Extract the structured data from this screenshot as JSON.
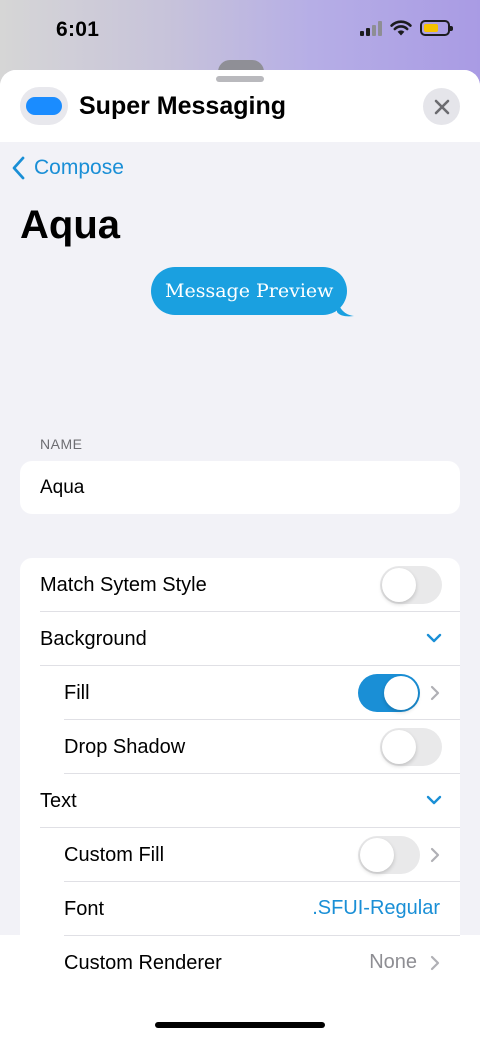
{
  "status_bar": {
    "time": "6:01",
    "battery_level": 0.62
  },
  "header": {
    "app_title": "Super Messaging"
  },
  "nav": {
    "back_label": "Compose"
  },
  "page": {
    "title": "Aqua"
  },
  "preview": {
    "text": "Message Preview",
    "bubble_color": "#1aa0e0"
  },
  "name_section": {
    "label": "NAME",
    "value": "Aqua"
  },
  "settings": {
    "match_system_style": {
      "label": "Match Sytem Style",
      "on": false
    },
    "background": {
      "label": "Background",
      "expanded": true
    },
    "fill": {
      "label": "Fill",
      "on": true
    },
    "drop_shadow": {
      "label": "Drop Shadow",
      "on": false
    },
    "text": {
      "label": "Text",
      "expanded": true
    },
    "custom_fill": {
      "label": "Custom Fill",
      "on": false
    },
    "font": {
      "label": "Font",
      "value": ".SFUI-Regular"
    },
    "custom_renderer": {
      "label": "Custom Renderer",
      "value": "None"
    }
  },
  "colors": {
    "accent": "#1a8fd6",
    "toggle_off": "#e9e9ea",
    "background": "#f2f2f7"
  }
}
